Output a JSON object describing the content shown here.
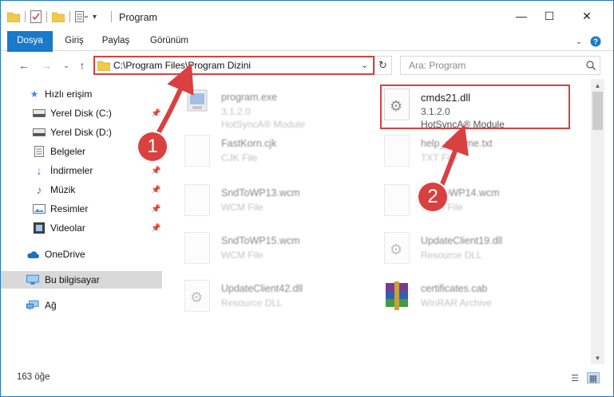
{
  "window": {
    "title": "Program",
    "minimize_glyph": "—",
    "maximize_glyph": "☐",
    "close_glyph": "✕"
  },
  "ribbon": {
    "tabs": [
      {
        "label": "Dosya",
        "active": true
      },
      {
        "label": "Giriş"
      },
      {
        "label": "Paylaş"
      },
      {
        "label": "Görünüm"
      }
    ]
  },
  "address": {
    "path": "C:\\Program Files\\Program Dizini",
    "search_placeholder": "Ara: Program"
  },
  "sidebar": {
    "items": [
      {
        "label": "Hızlı erişim",
        "icon": "star-icon"
      },
      {
        "label": "Yerel Disk (C:)",
        "icon": "drive-icon",
        "pinned": true
      },
      {
        "label": "Yerel Disk (D:)",
        "icon": "drive-icon"
      },
      {
        "label": "Belgeler",
        "icon": "documents-icon"
      },
      {
        "label": "İndirmeler",
        "icon": "download-icon",
        "pinned": true
      },
      {
        "label": "Müzik",
        "icon": "music-icon",
        "pinned": true
      },
      {
        "label": "Resimler",
        "icon": "pictures-icon",
        "pinned": true
      },
      {
        "label": "Videolar",
        "icon": "videos-icon",
        "pinned": true
      },
      {
        "label": "OneDrive",
        "icon": "cloud-icon"
      },
      {
        "label": "Bu bilgisayar",
        "icon": "computer-icon",
        "selected": true
      },
      {
        "label": "Ağ",
        "icon": "network-icon"
      }
    ]
  },
  "files": [
    {
      "name": "program.exe",
      "type": "3.1.2.0",
      "extra": "HotSyncA® Module"
    },
    {
      "name": "cmds21.dll",
      "type": "3.1.2.0",
      "extra": "HotSyncA® Module"
    },
    {
      "name": "FastKorn.cjk",
      "type": "CJK File"
    },
    {
      "name": "help_readme.txt",
      "type": "TXT File"
    },
    {
      "name": "SndToWP13.wcm",
      "type": "WCM File"
    },
    {
      "name": "SndToWP14.wcm",
      "type": "WCM File"
    },
    {
      "name": "SndToWP15.wcm",
      "type": "WCM File"
    },
    {
      "name": "UpdateClient19.dll",
      "type": "Resource DLL"
    },
    {
      "name": "UpdateClient42.dll",
      "type": "Resource DLL"
    },
    {
      "name": "certificates.cab",
      "type": "WinRAR Archive"
    }
  ],
  "status": {
    "item_count": "163 öğe"
  },
  "callouts": {
    "one": "1",
    "two": "2"
  },
  "colors": {
    "accent": "#1979ca",
    "highlight": "#d94040"
  }
}
